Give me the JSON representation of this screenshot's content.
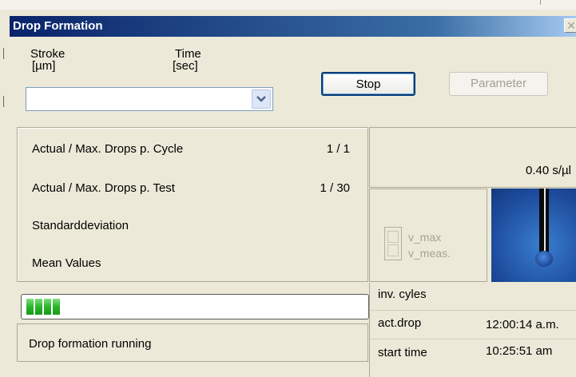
{
  "window": {
    "title": "Drop Formation",
    "close_glyph": "✕"
  },
  "header": {
    "stroke_label": "Stroke",
    "stroke_unit": "[µm]",
    "time_label": "Time",
    "time_unit": "[sec]",
    "combo_value": "",
    "combo_arrow": "▾"
  },
  "buttons": {
    "stop": "Stop",
    "parameter": "Parameter"
  },
  "stats": [
    {
      "label": "Actual / Max. Drops p. Cycle",
      "value": "1 / 1"
    },
    {
      "label": "Actual / Max. Drops p. Test",
      "value": "1 / 30"
    },
    {
      "label": "Standarddeviation",
      "value": ""
    },
    {
      "label": "Mean Values",
      "value": ""
    }
  ],
  "rate": "0.40 s/µl",
  "velocity": {
    "max_label": "v_max",
    "meas_label": "v_meas."
  },
  "progress": {
    "fraction": 0.11,
    "segments": 4
  },
  "status": "Drop formation running",
  "info": [
    {
      "label": "inv. cyles",
      "value": ""
    },
    {
      "label": "act.drop",
      "value": "12:00:14 a.m."
    },
    {
      "label": "start time",
      "value": "10:25:51 am"
    }
  ],
  "colors": {
    "title_bar_start": "#0a246a",
    "title_bar_end": "#a6caf0",
    "progress_fill": "#2bb52b",
    "camera_bg": "#1c4a9a"
  },
  "icons": {
    "combo": "chevron-down-icon",
    "close": "close-icon"
  }
}
